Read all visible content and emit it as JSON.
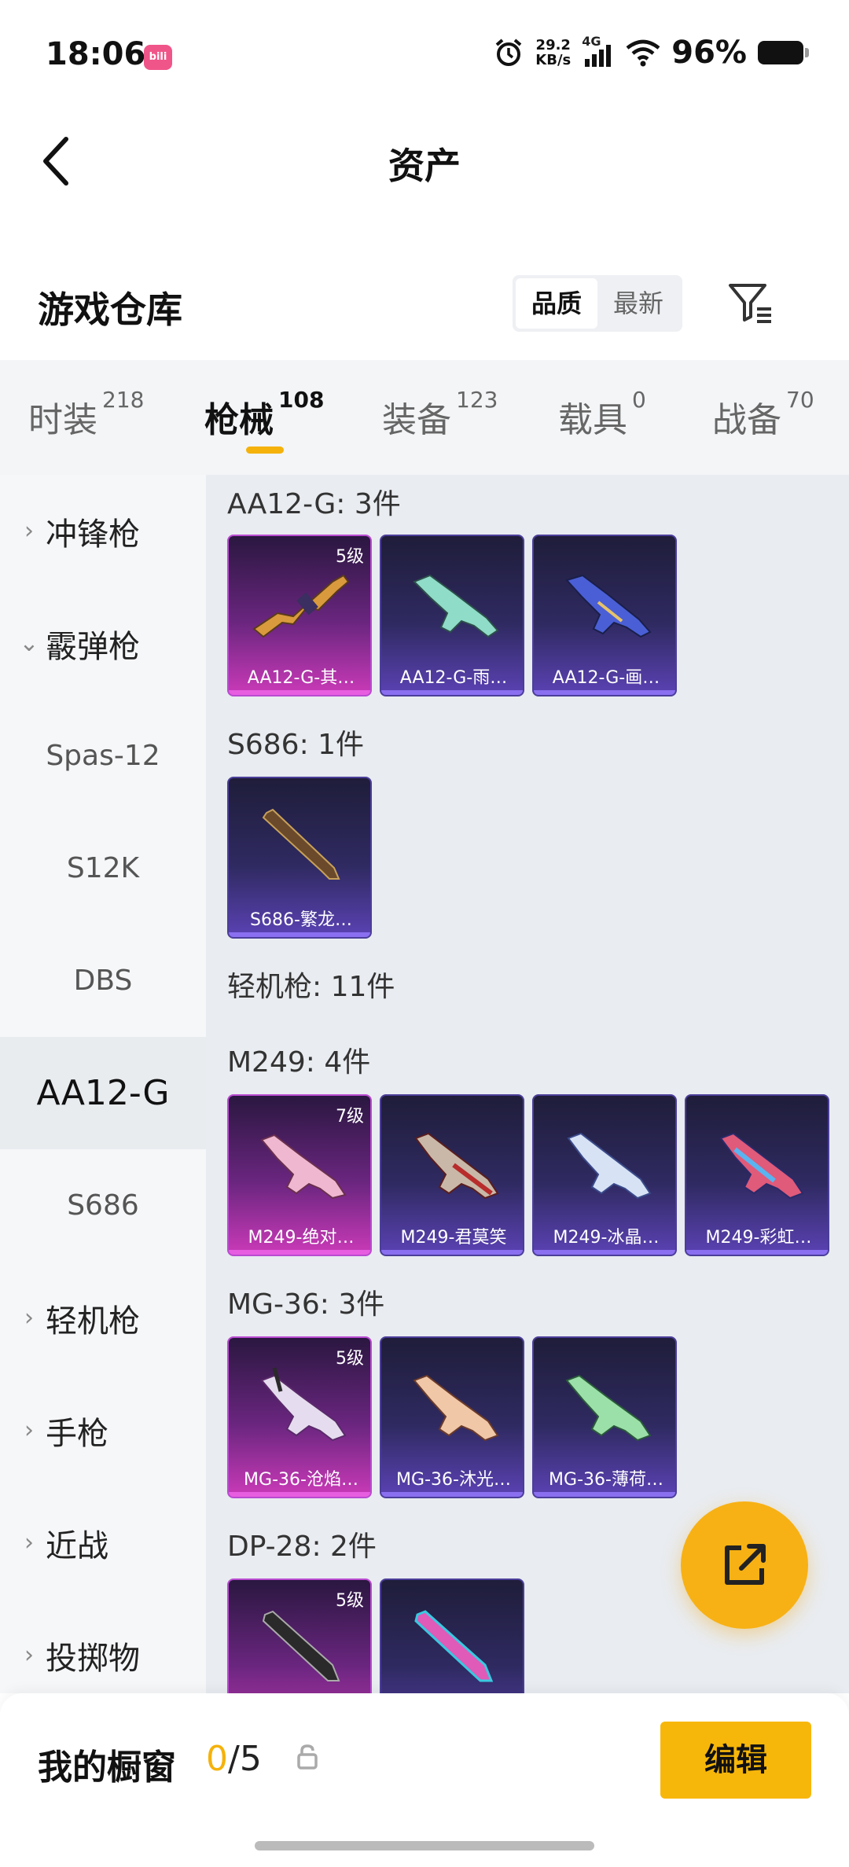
{
  "status": {
    "time": "18:06",
    "app_badge": "bilibili",
    "speed_value": "29.2",
    "speed_unit": "KB/s",
    "network": "4G",
    "battery": "96%"
  },
  "header": {
    "title": "资产"
  },
  "warehouse": {
    "title": "游戏仓库",
    "sort_options": [
      "品质",
      "最新"
    ],
    "sort_selected": "品质"
  },
  "tabs": [
    {
      "label": "时装",
      "count": "218"
    },
    {
      "label": "枪械",
      "count": "108",
      "active": true
    },
    {
      "label": "装备",
      "count": "123"
    },
    {
      "label": "载具",
      "count": "0"
    },
    {
      "label": "战备",
      "count": "70"
    }
  ],
  "sidebar": {
    "items": [
      {
        "label": "冲锋枪",
        "type": "category",
        "icon": "chevron-right-icon"
      },
      {
        "label": "霰弹枪",
        "type": "category",
        "icon": "chevron-down-icon"
      },
      {
        "label": "Spas-12",
        "type": "sub"
      },
      {
        "label": "S12K",
        "type": "sub"
      },
      {
        "label": "DBS",
        "type": "sub"
      },
      {
        "label": "AA12-G",
        "type": "sub",
        "active": true
      },
      {
        "label": "S686",
        "type": "sub"
      },
      {
        "label": "轻机枪",
        "type": "category",
        "icon": "chevron-right-icon"
      },
      {
        "label": "手枪",
        "type": "category",
        "icon": "chevron-right-icon"
      },
      {
        "label": "近战",
        "type": "category",
        "icon": "chevron-right-icon"
      },
      {
        "label": "投掷物",
        "type": "category",
        "icon": "chevron-right-icon"
      }
    ]
  },
  "content": {
    "groups": [
      {
        "title": "AA12-G: 3件",
        "items": [
          {
            "name": "AA12-G-其…",
            "level": "5级",
            "rarity": "gold"
          },
          {
            "name": "AA12-G-雨…",
            "level": "",
            "rarity": "purple"
          },
          {
            "name": "AA12-G-画…",
            "level": "",
            "rarity": "purple"
          }
        ]
      },
      {
        "title": "S686: 1件",
        "items": [
          {
            "name": "S686-繁龙…",
            "level": "",
            "rarity": "purple"
          }
        ]
      },
      {
        "title": "轻机枪: 11件",
        "items": []
      },
      {
        "title": "M249: 4件",
        "items": [
          {
            "name": "M249-绝对…",
            "level": "7级",
            "rarity": "gold"
          },
          {
            "name": "M249-君莫笑",
            "level": "",
            "rarity": "purple"
          },
          {
            "name": "M249-冰晶…",
            "level": "",
            "rarity": "purple"
          },
          {
            "name": "M249-彩虹…",
            "level": "",
            "rarity": "purple"
          }
        ]
      },
      {
        "title": "MG-36: 3件",
        "items": [
          {
            "name": "MG-36-沧焰…",
            "level": "5级",
            "rarity": "gold"
          },
          {
            "name": "MG-36-沐光…",
            "level": "",
            "rarity": "purple"
          },
          {
            "name": "MG-36-薄荷…",
            "level": "",
            "rarity": "purple"
          }
        ]
      },
      {
        "title": "DP-28: 2件",
        "items": [
          {
            "name": "",
            "level": "5级",
            "rarity": "gold"
          },
          {
            "name": "",
            "level": "",
            "rarity": "purple"
          }
        ]
      }
    ]
  },
  "showcase": {
    "label": "我的橱窗",
    "current": "0",
    "total": "/5",
    "edit_label": "编辑"
  },
  "colors": {
    "accent": "#f7b70a",
    "gold_card": "#cb3ab8",
    "purple_card": "#5b42b4"
  }
}
